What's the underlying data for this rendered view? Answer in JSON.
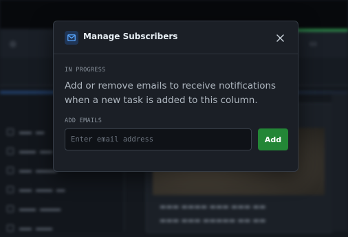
{
  "modal": {
    "title": "Manage Subscribers",
    "column_name": "IN PROGRESS",
    "description": "Add or remove emails to receive notifications when a new task is added to this column.",
    "emails_label": "ADD EMAILS",
    "email_input": {
      "value": "",
      "placeholder": "Enter email address"
    },
    "add_label": "Add",
    "icons": {
      "header": "mail-icon",
      "close": "close-icon"
    }
  },
  "colors": {
    "accent": "#238636",
    "modal_bg": "#1b1f26",
    "icon_badge": "#1f3556"
  }
}
